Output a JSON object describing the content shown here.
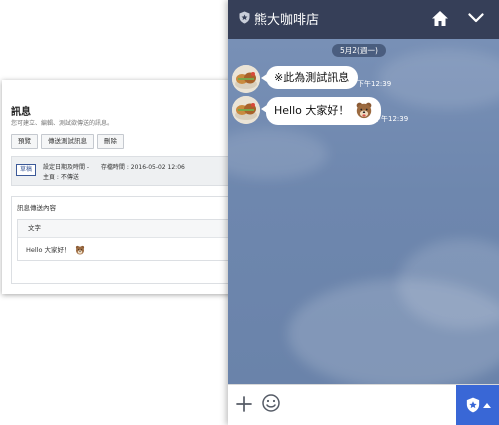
{
  "admin": {
    "title": "訊息",
    "subtitle": "您可建立、編輯、測試欲傳送的訊息。",
    "buttons": [
      "預覽",
      "傳送測試訊息",
      "刪除"
    ],
    "status": {
      "badge": "草稿",
      "schedule_label": "設定日期及時間 -",
      "saved_label": "存檔時間 : 2016-05-02 12:06",
      "audience_label": "主頁 : 不傳送"
    },
    "content": {
      "header": "訊息傳送內容",
      "type_label": "文字",
      "message_text": "Hello 大家好！"
    }
  },
  "chat": {
    "title": "熊大咖啡店",
    "date": "5月2(週一)",
    "messages": [
      {
        "text": "※此為測試訊息",
        "time": "下午12:39"
      },
      {
        "text": "Hello 大家好！",
        "time": "下午12:39",
        "sticker": "brown-bear-smiling"
      }
    ],
    "colors": {
      "header": "#363f58",
      "background": "#6f86ad",
      "bubble": "#ffffff",
      "accent": "#3967d6"
    }
  }
}
